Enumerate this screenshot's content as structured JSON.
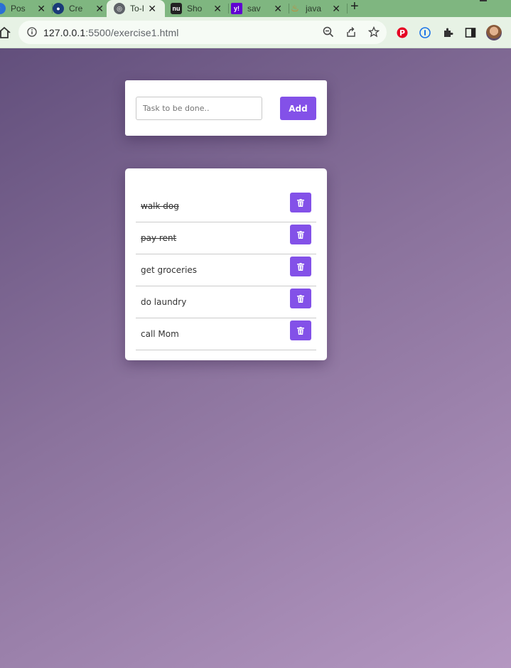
{
  "browser": {
    "tabs": [
      {
        "title": "Pos",
        "icon": "globe-icon",
        "active": false
      },
      {
        "title": "Cre",
        "icon": "profile-icon",
        "active": false
      },
      {
        "title": "To-I",
        "icon": "globe-icon",
        "active": true
      },
      {
        "title": "Sho",
        "icon": "nu-icon",
        "active": false
      },
      {
        "title": "sav",
        "icon": "yahoo-icon",
        "active": false
      },
      {
        "title": "java",
        "icon": "java-icon",
        "active": false
      }
    ],
    "new_tab_label": "+",
    "url_host": "127.0.0.1",
    "url_rest": ":5500/exercise1.html"
  },
  "app": {
    "input_placeholder": "Task to be done..",
    "add_label": "Add",
    "tasks": [
      {
        "text": "walk dog",
        "done": true
      },
      {
        "text": "pay rent",
        "done": true
      },
      {
        "text": "get groceries",
        "done": false
      },
      {
        "text": "do laundry",
        "done": false
      },
      {
        "text": "call Mom",
        "done": false
      }
    ]
  },
  "colors": {
    "accent": "#8351e8",
    "gradient_start": "#624f7c",
    "gradient_end": "#b497c1",
    "chrome": "#7fb680"
  }
}
